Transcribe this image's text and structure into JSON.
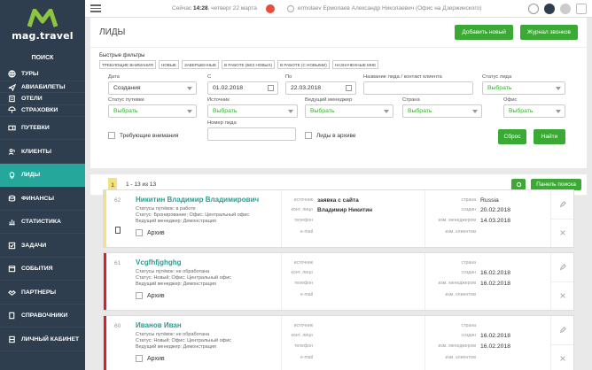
{
  "brand": {
    "name": "mag.travel",
    "color": "#8cc63f",
    "accent": "#25a89b"
  },
  "sidebar": {
    "search": "ПОИСК",
    "items": [
      {
        "label": "ТУРЫ",
        "icon": "globe-icon"
      },
      {
        "label": "АВИАБИЛЕТЫ",
        "icon": "plane-icon"
      },
      {
        "label": "ОТЕЛИ",
        "icon": "hotel-icon"
      },
      {
        "label": "СТРАХОВКИ",
        "icon": "umbrella-icon"
      },
      {
        "label": "ПУТЕВКИ",
        "icon": "ticket-icon"
      },
      {
        "label": "КЛИЕНТЫ",
        "icon": "users-icon"
      },
      {
        "label": "ЛИДЫ",
        "icon": "lightbulb-icon",
        "active": true
      },
      {
        "label": "ФИНАНСЫ",
        "icon": "coins-icon"
      },
      {
        "label": "СТАТИСТИКА",
        "icon": "chart-icon"
      },
      {
        "label": "ЗАДАЧИ",
        "icon": "tasks-icon"
      },
      {
        "label": "СОБЫТИЯ",
        "icon": "calendar-icon"
      },
      {
        "label": "ПАРТНЕРЫ",
        "icon": "partners-icon"
      },
      {
        "label": "СПРАВОЧНИКИ",
        "icon": "book-icon"
      },
      {
        "label": "ЛИЧНЫЙ КАБИНЕТ",
        "icon": "cabinet-icon"
      }
    ]
  },
  "topbar": {
    "date_prefix": "Сейчас ",
    "time": "14:28",
    "date_suffix": ", четверг 22 марта",
    "user": "ermolaev Ермолаев Александр Николаевич (Офис на Дзержинского)"
  },
  "page": {
    "title": "ЛИДЫ",
    "add_button": "Добавить новый",
    "journal_button": "Журнал звонков"
  },
  "filters": {
    "quick_label": "Быстрые фильтры",
    "quick": [
      "ТРЕБУЮЩИЕ ВНИМАНИЯ",
      "НОВЫЕ",
      "ЗАВЕРШЕННЫЕ",
      "В РАБОТЕ (БЕЗ НОВЫХ)",
      "В РАБОТЕ (С НОВЫМИ)",
      "НАЗНАЧЕННЫЕ МНЕ"
    ],
    "date_label": "Дата",
    "date_value": "Создания",
    "from_label": "С",
    "from_value": "01.02.2018",
    "to_label": "По",
    "to_value": "22.03.2018",
    "name_label": "Название лида / контакт клиента",
    "status_label": "Статус лида",
    "status_value": "Выбрать",
    "trip_status_label": "Статус путевки",
    "trip_status_value": "Выбрать",
    "source_label": "Источник",
    "source_value": "Выбрать",
    "manager_label": "Ведущий менеджер",
    "manager_value": "Выбрать",
    "country_label": "Страна",
    "country_value": "Выбрать",
    "office_label": "Офис",
    "office_value": "Выбрать",
    "attention_label": "Требующие внимания",
    "number_label": "Номер лида",
    "archive_label": "Лиды в архиве",
    "reset_button": "Сброс",
    "find_button": "Найти"
  },
  "results": {
    "page": "1",
    "count": "1 - 13 из 13",
    "search_panel_button": "Панель поиска"
  },
  "labels": {
    "source": "источник",
    "contact": "конт. лицо",
    "phone": "телефон",
    "email": "e-mail",
    "country": "страна",
    "created": "создан",
    "changed": "изм. менеджером",
    "changed_client": "изм. клиентом",
    "archive": "Архив"
  },
  "leads": [
    {
      "num": "62",
      "name": "Никитин Владимир Владимирович",
      "trip_status": "Статусы путёвок: в работе",
      "status": "Статус: Бронирование; Офис: Центральный офис",
      "manager": "Ведущий менеджер: Демонстрация",
      "source": "заявка с сайта",
      "contact": "Владимир Никитин",
      "country": "Russia",
      "created": "20.02.2018",
      "changed": "14.03.2018",
      "stripe": "#f6e27d"
    },
    {
      "num": "61",
      "name": "Vcgfhfjghghg",
      "trip_status": "Статусы путёвок: не обработана",
      "status": "Статус: Новый; Офис: Центральный офис",
      "manager": "Ведущий менеджер: Демонстрация",
      "source": "",
      "contact": "",
      "country": "",
      "created": "16.02.2018",
      "changed": "16.02.2018",
      "stripe": "#e31b23"
    },
    {
      "num": "60",
      "name": "Иванов Иван",
      "trip_status": "Статусы путёвок: не обработана",
      "status": "Статус: Новый; Офис: Центральный офис",
      "manager": "Ведущий менеджер: Демонстрация",
      "source": "",
      "contact": "",
      "country": "",
      "created": "16.02.2018",
      "changed": "16.02.2018",
      "stripe": "#e31b23"
    }
  ]
}
